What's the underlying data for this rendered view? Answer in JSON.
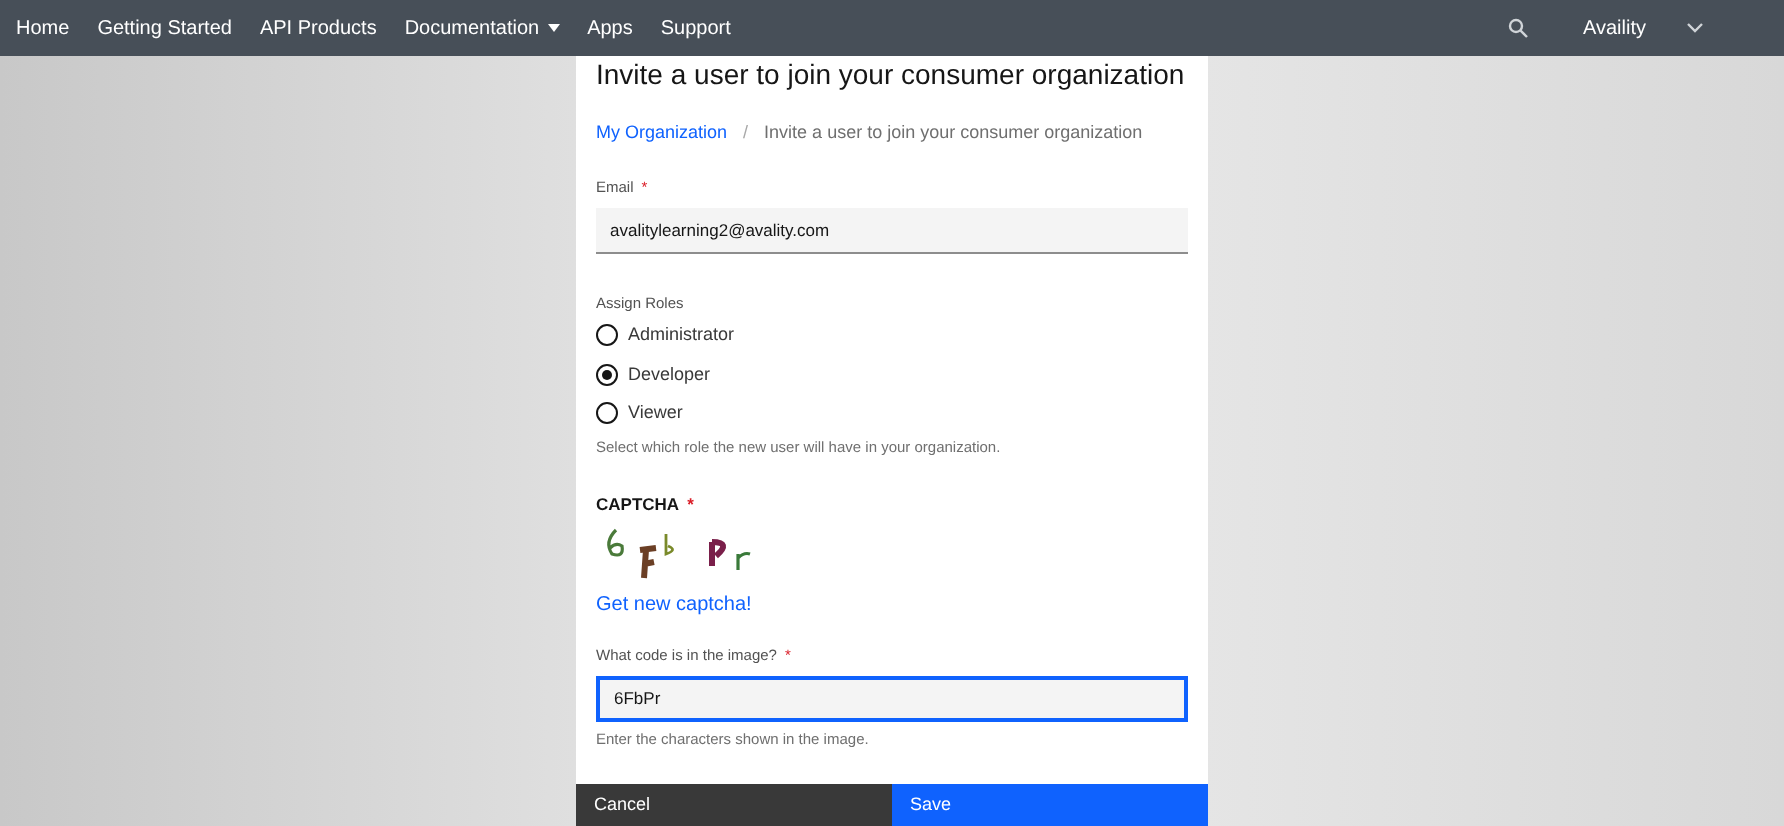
{
  "nav": {
    "items": [
      {
        "label": "Home",
        "dropdown": false
      },
      {
        "label": "Getting Started",
        "dropdown": false
      },
      {
        "label": "API Products",
        "dropdown": false
      },
      {
        "label": "Documentation",
        "dropdown": true
      },
      {
        "label": "Apps",
        "dropdown": false
      },
      {
        "label": "Support",
        "dropdown": false
      }
    ],
    "account": "Availity"
  },
  "dialog": {
    "title": "Invite a user to join your consumer organization",
    "breadcrumb": [
      {
        "label": "My Organization",
        "link": true
      },
      {
        "label": "Invite a user to join your consumer organization",
        "link": false
      }
    ],
    "breadcrumb_separator": "/",
    "email": {
      "label": "Email",
      "required_mark": "*",
      "value": "avalitylearning2@avality.com"
    },
    "roles": {
      "label": "Assign Roles",
      "options": [
        {
          "label": "Administrator",
          "selected": false
        },
        {
          "label": "Developer",
          "selected": true
        },
        {
          "label": "Viewer",
          "selected": false
        }
      ],
      "help": "Select which role the new user will have in your organization."
    },
    "captcha": {
      "label": "CAPTCHA",
      "required_mark": "*",
      "refresh": "Get new captcha!",
      "field_label": "What code is in the image?",
      "field_required_mark": "*",
      "value": "6FbPr",
      "help": "Enter the characters shown in the image."
    },
    "buttons": [
      {
        "label": "Cancel",
        "kind": "secondary"
      },
      {
        "label": "Save",
        "kind": "primary"
      }
    ]
  }
}
